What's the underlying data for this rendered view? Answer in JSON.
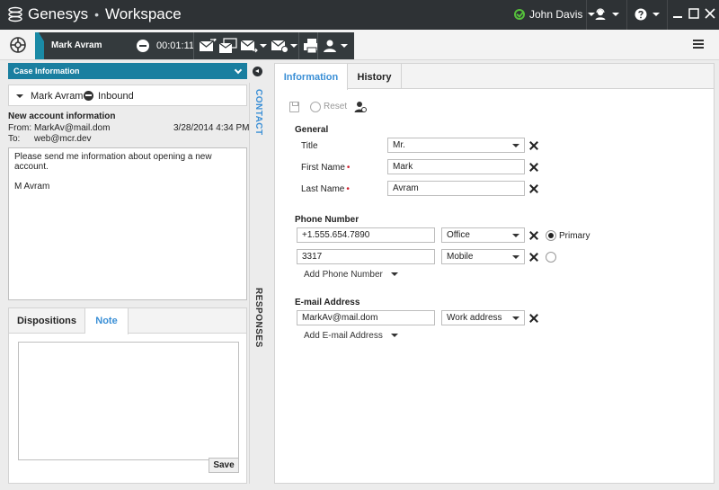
{
  "titlebar": {
    "brand": "Genesys",
    "separator": "•",
    "app": "Workspace",
    "user": "John Davis"
  },
  "toolbar": {
    "contact_name": "Mark Avram",
    "timer": "00:01:11"
  },
  "case": {
    "header": "Case Information",
    "party_name": "Mark Avram",
    "direction": "Inbound"
  },
  "email": {
    "subject": "New account information",
    "from_label": "From:",
    "from": "MarkAv@mail.dom",
    "date": "3/28/2014 4:34 PM",
    "to_label": "To:",
    "to": "web@mcr.dev",
    "body_line1": "Please send me information about opening a new account.",
    "body_line2": "M Avram"
  },
  "side_tabs": {
    "contact": "CONTACT",
    "responses": "RESPONSES"
  },
  "lower_tabs": {
    "dispositions": "Dispositions",
    "note": "Note",
    "save": "Save"
  },
  "right_tabs": {
    "information": "Information",
    "history": "History"
  },
  "actions": {
    "reset": "Reset"
  },
  "general": {
    "section": "General",
    "title_label": "Title",
    "title_value": "Mr.",
    "first_name_label": "First Name",
    "first_name_value": "Mark",
    "last_name_label": "Last Name",
    "last_name_value": "Avram",
    "required_mark": "•"
  },
  "phone": {
    "section": "Phone Number",
    "entries": [
      {
        "number": "+1.555.654.7890",
        "type": "Office",
        "primary": true
      },
      {
        "number": "3317",
        "type": "Mobile",
        "primary": false
      }
    ],
    "primary_label": "Primary",
    "add_label": "Add Phone Number"
  },
  "email_address": {
    "section": "E-mail Address",
    "value": "MarkAv@mail.dom",
    "type": "Work address",
    "add_label": "Add E-mail Address"
  },
  "colors": {
    "titlebar": "#2e3235",
    "accent": "#1a7fa0",
    "active_tab": "#3a8fd6",
    "status_ready": "#55c03b",
    "required": "#d0202e"
  }
}
